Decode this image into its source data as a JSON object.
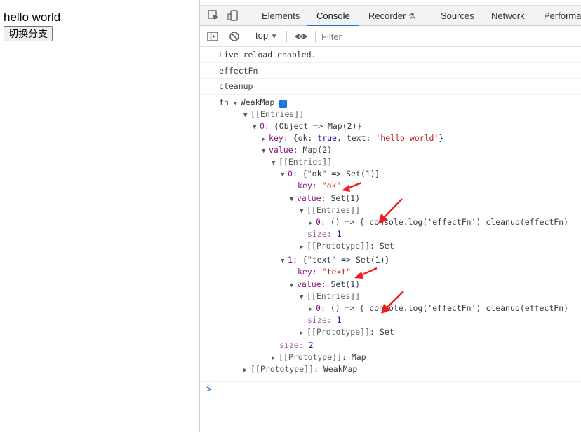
{
  "page": {
    "title": "hello world",
    "button_label": "切换分支"
  },
  "devtools": {
    "tabs": [
      "Elements",
      "Console",
      "Recorder",
      "Sources",
      "Network",
      "Performa"
    ],
    "active_tab": "Console",
    "context": "top",
    "filter_placeholder": "Filter",
    "accent": "#1a73e8"
  },
  "console": {
    "messages": [
      "Live reload enabled.",
      "effectFn",
      "cleanup"
    ],
    "tree": {
      "label": "fn",
      "root": "WeakMap",
      "entries": "[[Entries]]",
      "entry0": "{Object => Map(2)}",
      "entry0_index": "0",
      "key_label": "key",
      "key_value": "{ok: true, text: 'hello world'}",
      "value_label": "value",
      "value_map": "Map(2)",
      "map_entries": "[[Entries]]",
      "ok_index": "0",
      "ok_entry": "{\"ok\" => Set(1)}",
      "ok_key": "\"ok\"",
      "set1": "Set(1)",
      "set_entries": "[[Entries]]",
      "fn_index": "0",
      "fn_text": "() => { console.log('effectFn') cleanup(effectFn)",
      "size_label": "size",
      "size_one": "1",
      "proto_label": "[[Prototype]]",
      "proto_set": "Set",
      "text_index": "1",
      "text_entry": "{\"text\" => Set(1)}",
      "text_key": "\"text\"",
      "size_two": "2",
      "proto_map": "Map",
      "proto_weakmap": "WeakMap"
    },
    "prompt": ">"
  }
}
